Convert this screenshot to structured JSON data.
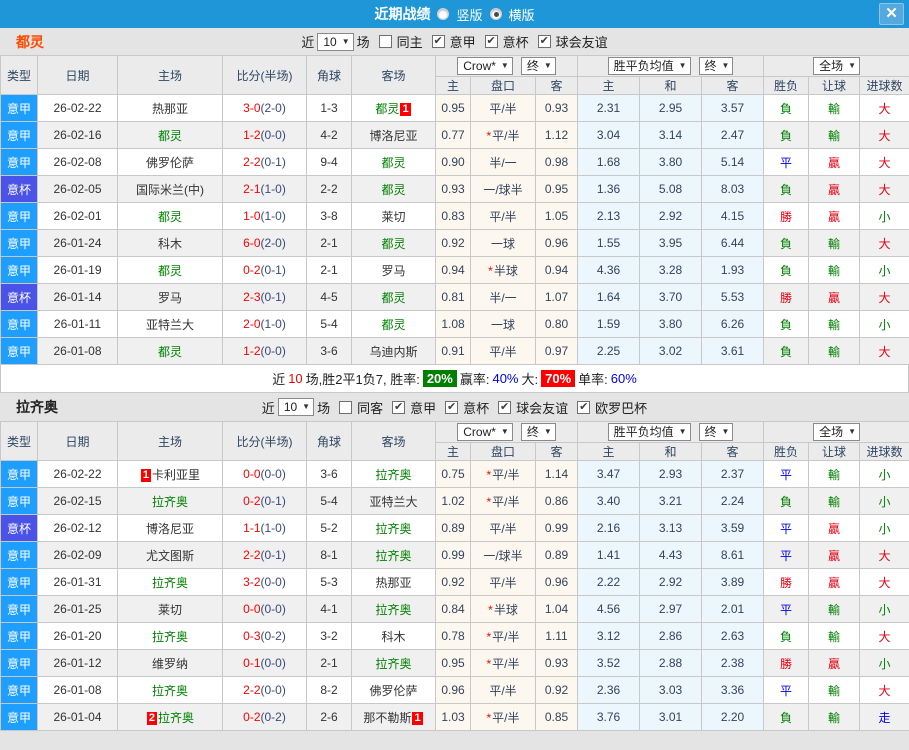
{
  "titlebar": {
    "title": "近期战绩",
    "vertical_label": "竖版",
    "horizontal_label": "横版",
    "close_glyph": "✕"
  },
  "labels": {
    "near": "近",
    "games": "场"
  },
  "dropdowns": {
    "count": "10",
    "bookmaker": "Crow*",
    "final": "终",
    "mean": "胜平负均值",
    "scope": "全场"
  },
  "columns": {
    "type": "类型",
    "date": "日期",
    "home": "主场",
    "score": "比分(半场)",
    "corner": "角球",
    "away": "客场",
    "odds_home": "主",
    "odds_line": "盘口",
    "odds_away": "客",
    "mean_home": "主",
    "mean_draw": "和",
    "mean_away": "客",
    "result": "胜负",
    "handicap": "让球",
    "goals": "进球数"
  },
  "value_colors": {
    "勝": "#E60012",
    "平": "#0000EE",
    "負": "#008000",
    "贏": "#E60012",
    "輸": "#008000",
    "大": "#E60012",
    "小": "#008000",
    "走": "#0000EE"
  },
  "colors": {
    "titlebar_blue": "#1E96D8",
    "serie_a_blue": "#1E9FFF",
    "cup_indigo": "#4A52E8",
    "focus_green": "#008000",
    "score_red": "#FF0000",
    "odds_bg": "#FDF8EF",
    "mean_bg": "#EBF7FD"
  },
  "sections": [
    {
      "team": "都灵",
      "team_color": "#FF4A00",
      "same_label": "同主",
      "leagues": [
        "意甲",
        "意杯",
        "球会友谊"
      ],
      "rows": [
        {
          "league": "意甲",
          "cup": false,
          "date": "26-02-22",
          "home": "热那亚",
          "home_focus": false,
          "ft": "3-0",
          "ht": "(2-0)",
          "corners": "1-3",
          "away": "都灵",
          "away_focus": true,
          "away_badge_post": "1",
          "odds_home": "0.95",
          "line": "平/半",
          "line_star": false,
          "odds_away": "0.93",
          "mean_home": "2.31",
          "mean_draw": "2.95",
          "mean_away": "3.57",
          "result": "負",
          "handicap": "輸",
          "goals": "大"
        },
        {
          "league": "意甲",
          "cup": false,
          "date": "26-02-16",
          "home": "都灵",
          "home_focus": true,
          "ft": "1-2",
          "ht": "(0-0)",
          "corners": "4-2",
          "away": "博洛尼亚",
          "away_focus": false,
          "odds_home": "0.77",
          "line": "平/半",
          "line_star": true,
          "odds_away": "1.12",
          "mean_home": "3.04",
          "mean_draw": "3.14",
          "mean_away": "2.47",
          "result": "負",
          "handicap": "輸",
          "goals": "大"
        },
        {
          "league": "意甲",
          "cup": false,
          "date": "26-02-08",
          "home": "佛罗伦萨",
          "home_focus": false,
          "ft": "2-2",
          "ht": "(0-1)",
          "corners": "9-4",
          "away": "都灵",
          "away_focus": true,
          "odds_home": "0.90",
          "line": "半/一",
          "line_star": false,
          "odds_away": "0.98",
          "mean_home": "1.68",
          "mean_draw": "3.80",
          "mean_away": "5.14",
          "result": "平",
          "handicap": "贏",
          "goals": "大"
        },
        {
          "league": "意杯",
          "cup": true,
          "date": "26-02-05",
          "home": "国际米兰(中)",
          "home_focus": false,
          "ft": "2-1",
          "ht": "(1-0)",
          "corners": "2-2",
          "away": "都灵",
          "away_focus": true,
          "odds_home": "0.93",
          "line": "一/球半",
          "line_star": false,
          "odds_away": "0.95",
          "mean_home": "1.36",
          "mean_draw": "5.08",
          "mean_away": "8.03",
          "result": "負",
          "handicap": "贏",
          "goals": "大"
        },
        {
          "league": "意甲",
          "cup": false,
          "date": "26-02-01",
          "home": "都灵",
          "home_focus": true,
          "ft": "1-0",
          "ht": "(1-0)",
          "corners": "3-8",
          "away": "莱切",
          "away_focus": false,
          "odds_home": "0.83",
          "line": "平/半",
          "line_star": false,
          "odds_away": "1.05",
          "mean_home": "2.13",
          "mean_draw": "2.92",
          "mean_away": "4.15",
          "result": "勝",
          "handicap": "贏",
          "goals": "小"
        },
        {
          "league": "意甲",
          "cup": false,
          "date": "26-01-24",
          "home": "科木",
          "home_focus": false,
          "ft": "6-0",
          "ht": "(2-0)",
          "corners": "2-1",
          "away": "都灵",
          "away_focus": true,
          "odds_home": "0.92",
          "line": "一球",
          "line_star": false,
          "odds_away": "0.96",
          "mean_home": "1.55",
          "mean_draw": "3.95",
          "mean_away": "6.44",
          "result": "負",
          "handicap": "輸",
          "goals": "大"
        },
        {
          "league": "意甲",
          "cup": false,
          "date": "26-01-19",
          "home": "都灵",
          "home_focus": true,
          "ft": "0-2",
          "ht": "(0-1)",
          "corners": "2-1",
          "away": "罗马",
          "away_focus": false,
          "odds_home": "0.94",
          "line": "半球",
          "line_star": true,
          "odds_away": "0.94",
          "mean_home": "4.36",
          "mean_draw": "3.28",
          "mean_away": "1.93",
          "result": "負",
          "handicap": "輸",
          "goals": "小"
        },
        {
          "league": "意杯",
          "cup": true,
          "date": "26-01-14",
          "home": "罗马",
          "home_focus": false,
          "ft": "2-3",
          "ht": "(0-1)",
          "corners": "4-5",
          "away": "都灵",
          "away_focus": true,
          "odds_home": "0.81",
          "line": "半/一",
          "line_star": false,
          "odds_away": "1.07",
          "mean_home": "1.64",
          "mean_draw": "3.70",
          "mean_away": "5.53",
          "result": "勝",
          "handicap": "贏",
          "goals": "大"
        },
        {
          "league": "意甲",
          "cup": false,
          "date": "26-01-11",
          "home": "亚特兰大",
          "home_focus": false,
          "ft": "2-0",
          "ht": "(1-0)",
          "corners": "5-4",
          "away": "都灵",
          "away_focus": true,
          "odds_home": "1.08",
          "line": "一球",
          "line_star": false,
          "odds_away": "0.80",
          "mean_home": "1.59",
          "mean_draw": "3.80",
          "mean_away": "6.26",
          "result": "負",
          "handicap": "輸",
          "goals": "小"
        },
        {
          "league": "意甲",
          "cup": false,
          "date": "26-01-08",
          "home": "都灵",
          "home_focus": true,
          "ft": "1-2",
          "ht": "(0-0)",
          "corners": "3-6",
          "away": "乌迪内斯",
          "away_focus": false,
          "odds_home": "0.91",
          "line": "平/半",
          "line_star": false,
          "odds_away": "0.97",
          "mean_home": "2.25",
          "mean_draw": "3.02",
          "mean_away": "3.61",
          "result": "負",
          "handicap": "輸",
          "goals": "大"
        }
      ],
      "summary": {
        "near": "近",
        "count": "10",
        "rest": "场,胜2平1负7, 胜率:",
        "win_pct": "20%",
        "win_rate_label": "赢率:",
        "win_rate": "40%",
        "big_label": "大:",
        "big_pct": "70%",
        "single_label": "单率:",
        "single_rate": "60%"
      }
    },
    {
      "team": "拉齐奥",
      "team_color": "#222222",
      "same_label": "同客",
      "leagues": [
        "意甲",
        "意杯",
        "球会友谊",
        "欧罗巴杯"
      ],
      "rows": [
        {
          "league": "意甲",
          "cup": false,
          "date": "26-02-22",
          "home": "卡利亚里",
          "home_focus": false,
          "home_badge_pre": "1",
          "ft": "0-0",
          "ht": "(0-0)",
          "corners": "3-6",
          "away": "拉齐奥",
          "away_focus": true,
          "odds_home": "0.75",
          "line": "平/半",
          "line_star": true,
          "odds_away": "1.14",
          "mean_home": "3.47",
          "mean_draw": "2.93",
          "mean_away": "2.37",
          "result": "平",
          "handicap": "輸",
          "goals": "小"
        },
        {
          "league": "意甲",
          "cup": false,
          "date": "26-02-15",
          "home": "拉齐奥",
          "home_focus": true,
          "ft": "0-2",
          "ht": "(0-1)",
          "corners": "5-4",
          "away": "亚特兰大",
          "away_focus": false,
          "odds_home": "1.02",
          "line": "平/半",
          "line_star": true,
          "odds_away": "0.86",
          "mean_home": "3.40",
          "mean_draw": "3.21",
          "mean_away": "2.24",
          "result": "負",
          "handicap": "輸",
          "goals": "小"
        },
        {
          "league": "意杯",
          "cup": true,
          "date": "26-02-12",
          "home": "博洛尼亚",
          "home_focus": false,
          "ft": "1-1",
          "ht": "(1-0)",
          "corners": "5-2",
          "away": "拉齐奥",
          "away_focus": true,
          "odds_home": "0.89",
          "line": "平/半",
          "line_star": false,
          "odds_away": "0.99",
          "mean_home": "2.16",
          "mean_draw": "3.13",
          "mean_away": "3.59",
          "result": "平",
          "handicap": "贏",
          "goals": "小"
        },
        {
          "league": "意甲",
          "cup": false,
          "date": "26-02-09",
          "home": "尤文图斯",
          "home_focus": false,
          "ft": "2-2",
          "ht": "(0-1)",
          "corners": "8-1",
          "away": "拉齐奥",
          "away_focus": true,
          "odds_home": "0.99",
          "line": "一/球半",
          "line_star": false,
          "odds_away": "0.89",
          "mean_home": "1.41",
          "mean_draw": "4.43",
          "mean_away": "8.61",
          "result": "平",
          "handicap": "贏",
          "goals": "大"
        },
        {
          "league": "意甲",
          "cup": false,
          "date": "26-01-31",
          "home": "拉齐奥",
          "home_focus": true,
          "ft": "3-2",
          "ht": "(0-0)",
          "corners": "5-3",
          "away": "热那亚",
          "away_focus": false,
          "odds_home": "0.92",
          "line": "平/半",
          "line_star": false,
          "odds_away": "0.96",
          "mean_home": "2.22",
          "mean_draw": "2.92",
          "mean_away": "3.89",
          "result": "勝",
          "handicap": "贏",
          "goals": "大"
        },
        {
          "league": "意甲",
          "cup": false,
          "date": "26-01-25",
          "home": "莱切",
          "home_focus": false,
          "ft": "0-0",
          "ht": "(0-0)",
          "corners": "4-1",
          "away": "拉齐奥",
          "away_focus": true,
          "odds_home": "0.84",
          "line": "半球",
          "line_star": true,
          "odds_away": "1.04",
          "mean_home": "4.56",
          "mean_draw": "2.97",
          "mean_away": "2.01",
          "result": "平",
          "handicap": "輸",
          "goals": "小"
        },
        {
          "league": "意甲",
          "cup": false,
          "date": "26-01-20",
          "home": "拉齐奥",
          "home_focus": true,
          "ft": "0-3",
          "ht": "(0-2)",
          "corners": "3-2",
          "away": "科木",
          "away_focus": false,
          "odds_home": "0.78",
          "line": "平/半",
          "line_star": true,
          "odds_away": "1.11",
          "mean_home": "3.12",
          "mean_draw": "2.86",
          "mean_away": "2.63",
          "result": "負",
          "handicap": "輸",
          "goals": "大"
        },
        {
          "league": "意甲",
          "cup": false,
          "date": "26-01-12",
          "home": "维罗纳",
          "home_focus": false,
          "ft": "0-1",
          "ht": "(0-0)",
          "corners": "2-1",
          "away": "拉齐奥",
          "away_focus": true,
          "odds_home": "0.95",
          "line": "平/半",
          "line_star": true,
          "odds_away": "0.93",
          "mean_home": "3.52",
          "mean_draw": "2.88",
          "mean_away": "2.38",
          "result": "勝",
          "handicap": "贏",
          "goals": "小"
        },
        {
          "league": "意甲",
          "cup": false,
          "date": "26-01-08",
          "home": "拉齐奥",
          "home_focus": true,
          "ft": "2-2",
          "ht": "(0-0)",
          "corners": "8-2",
          "away": "佛罗伦萨",
          "away_focus": false,
          "odds_home": "0.96",
          "line": "平/半",
          "line_star": false,
          "odds_away": "0.92",
          "mean_home": "2.36",
          "mean_draw": "3.03",
          "mean_away": "3.36",
          "result": "平",
          "handicap": "輸",
          "goals": "大"
        },
        {
          "league": "意甲",
          "cup": false,
          "date": "26-01-04",
          "home": "拉齐奥",
          "home_focus": true,
          "home_badge_pre": "2",
          "ft": "0-2",
          "ht": "(0-2)",
          "corners": "2-6",
          "away": "那不勒斯",
          "away_focus": false,
          "away_badge_post": "1",
          "odds_home": "1.03",
          "line": "平/半",
          "line_star": true,
          "odds_away": "0.85",
          "mean_home": "3.76",
          "mean_draw": "3.01",
          "mean_away": "2.20",
          "result": "負",
          "handicap": "輸",
          "goals": "走"
        }
      ]
    }
  ]
}
